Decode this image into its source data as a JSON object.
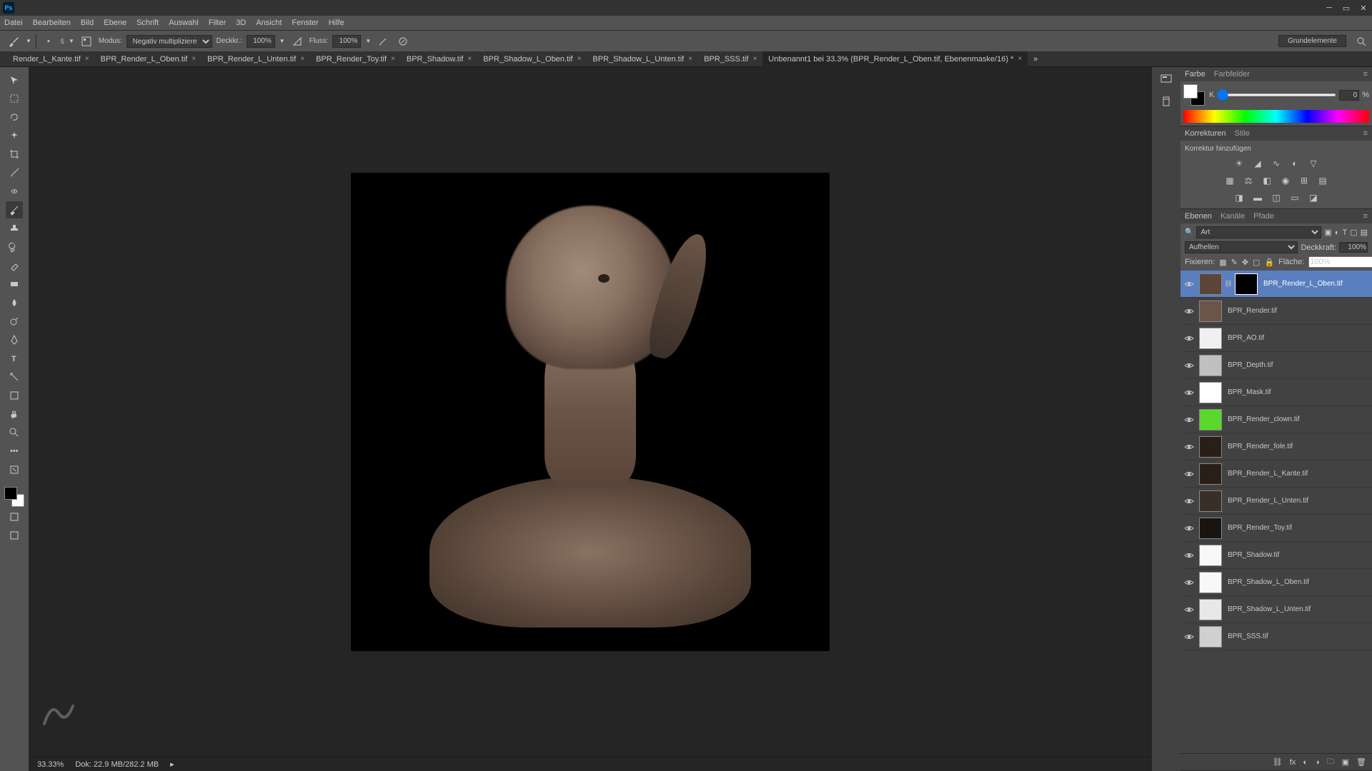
{
  "menubar": [
    "Datei",
    "Bearbeiten",
    "Bild",
    "Ebene",
    "Schrift",
    "Auswahl",
    "Filter",
    "3D",
    "Ansicht",
    "Fenster",
    "Hilfe"
  ],
  "optionsbar": {
    "mode_label": "Modus:",
    "mode_value": "Negativ multiplizieren",
    "opacity_label": "Deckkr.:",
    "opacity_value": "100%",
    "flow_label": "Fluss:",
    "flow_value": "100%",
    "brush_size": "5",
    "right_label": "Grundelemente"
  },
  "tabs": [
    {
      "label": "Render_L_Kante.tif",
      "active": false
    },
    {
      "label": "BPR_Render_L_Oben.tif",
      "active": false
    },
    {
      "label": "BPR_Render_L_Unten.tif",
      "active": false
    },
    {
      "label": "BPR_Render_Toy.tif",
      "active": false
    },
    {
      "label": "BPR_Shadow.tif",
      "active": false
    },
    {
      "label": "BPR_Shadow_L_Oben.tif",
      "active": false
    },
    {
      "label": "BPR_Shadow_L_Unten.tif",
      "active": false
    },
    {
      "label": "BPR_SSS.tif",
      "active": false
    },
    {
      "label": "Unbenannt1 bei 33.3% (BPR_Render_L_Oben.tif, Ebenenmaske/16) *",
      "active": true
    }
  ],
  "statusbar": {
    "zoom": "33.33%",
    "doc": "Dok: 22.9 MB/282.2 MB"
  },
  "panels": {
    "color": {
      "tabs": [
        "Farbe",
        "Farbfelder"
      ],
      "channel_label": "K",
      "channel_value": "0",
      "channel_unit": "%"
    },
    "adjust": {
      "tabs": [
        "Korrekturen",
        "Stile"
      ],
      "hint": "Korrektur hinzufügen"
    },
    "layers": {
      "tabs": [
        "Ebenen",
        "Kanäle",
        "Pfade"
      ],
      "filter_label": "Art",
      "blend_mode": "Aufhellen",
      "opacity_label": "Deckkraft:",
      "opacity_value": "100%",
      "lock_label": "Fixieren:",
      "fill_label": "Fläche:",
      "fill_value": "100%",
      "items": [
        {
          "name": "BPR_Render_L_Oben.tif",
          "selected": true,
          "mask": true,
          "thumb": "#5a4538"
        },
        {
          "name": "BPR_Render.tif",
          "selected": false,
          "mask": false,
          "thumb": "#6b5548"
        },
        {
          "name": "BPR_AO.tif",
          "selected": false,
          "mask": false,
          "thumb": "#f0f0f0"
        },
        {
          "name": "BPR_Depth.tif",
          "selected": false,
          "mask": false,
          "thumb": "#c0c0c0"
        },
        {
          "name": "BPR_Mask.tif",
          "selected": false,
          "mask": false,
          "thumb": "#ffffff"
        },
        {
          "name": "BPR_Render_clown.tif",
          "selected": false,
          "mask": false,
          "thumb": "#5bd82e"
        },
        {
          "name": "BPR_Render_fole.tif",
          "selected": false,
          "mask": false,
          "thumb": "#2a1f18"
        },
        {
          "name": "BPR_Render_L_Kante.tif",
          "selected": false,
          "mask": false,
          "thumb": "#2a1f18"
        },
        {
          "name": "BPR_Render_L_Unten.tif",
          "selected": false,
          "mask": false,
          "thumb": "#3a2f28"
        },
        {
          "name": "BPR_Render_Toy.tif",
          "selected": false,
          "mask": false,
          "thumb": "#1a1410"
        },
        {
          "name": "BPR_Shadow.tif",
          "selected": false,
          "mask": false,
          "thumb": "#f8f8f8"
        },
        {
          "name": "BPR_Shadow_L_Oben.tif",
          "selected": false,
          "mask": false,
          "thumb": "#f8f8f8"
        },
        {
          "name": "BPR_Shadow_L_Unten.tif",
          "selected": false,
          "mask": false,
          "thumb": "#e8e8e8"
        },
        {
          "name": "BPR_SSS.tif",
          "selected": false,
          "mask": false,
          "thumb": "#d0d0d0"
        }
      ]
    }
  }
}
